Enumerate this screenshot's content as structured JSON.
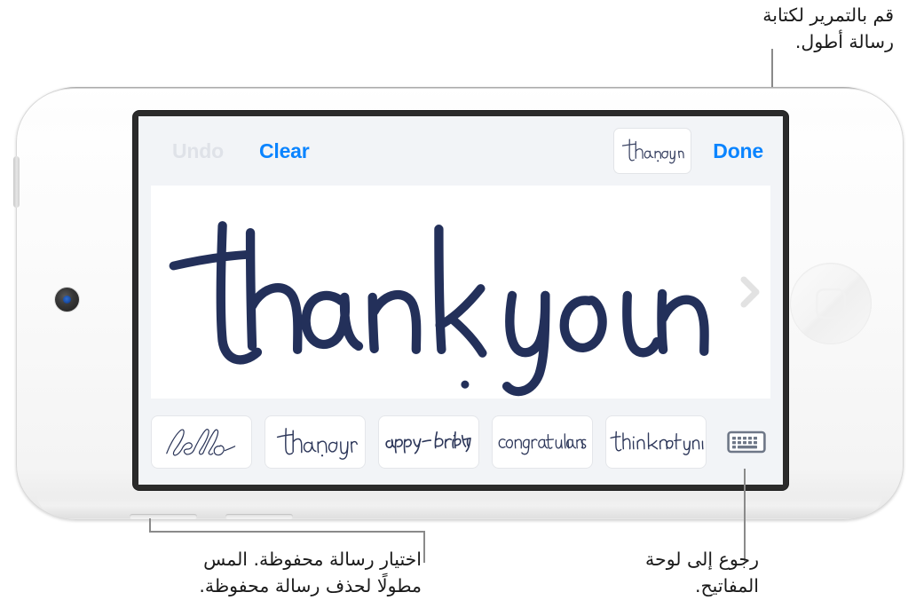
{
  "annotations": {
    "top": "قم بالتمرير لكتابة\nرسالة أطول.",
    "bottom_left": "اختيار رسالة محفوظة. المس\nمطولًا لحذف رسالة محفوظة.",
    "bottom_right": "رجوع إلى لوحة\nالمفاتيح."
  },
  "screen": {
    "toolbar": {
      "undo_label": "Undo",
      "clear_label": "Clear",
      "done_label": "Done",
      "preview_text": "thank you",
      "undo_enabled": false,
      "accent_color": "#0a84ff",
      "disabled_color": "#dfe2e8",
      "background_color": "#f2f4f7"
    },
    "canvas": {
      "handwriting_text": "thank you",
      "ink_color": "#23305a",
      "background_color": "#ffffff",
      "next_arrow_icon": "chevron-right-icon",
      "next_arrow_color": "#e2e2e2"
    },
    "saved_messages": [
      {
        "text": "hello",
        "style": "script"
      },
      {
        "text": "thank you",
        "style": "print"
      },
      {
        "text": "happy birthday",
        "style": "slanted"
      },
      {
        "text": "congratulations",
        "style": "print"
      },
      {
        "text": "thinking of you",
        "style": "print"
      }
    ],
    "keyboard_button": {
      "icon": "keyboard-icon",
      "color": "#6e7787"
    }
  },
  "device": {
    "color": "#ffffff",
    "camera_icon": "camera-lens-icon",
    "home_button_icon": "home-square-icon",
    "speaker_count": 2,
    "volume_button": "volume-button"
  }
}
